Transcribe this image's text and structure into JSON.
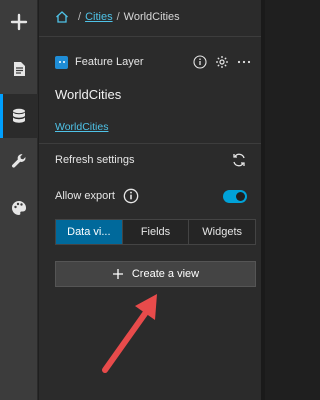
{
  "rail": {
    "items": [
      {
        "icon": "plus-icon"
      },
      {
        "icon": "page-icon"
      },
      {
        "icon": "data-icon",
        "active": true
      },
      {
        "icon": "wrench-icon"
      },
      {
        "icon": "palette-icon"
      }
    ]
  },
  "breadcrumb": {
    "home_icon": "home-icon",
    "link": "Cities",
    "current": "WorldCities",
    "separator": "/"
  },
  "layer": {
    "type_label": "Feature Layer",
    "title": "WorldCities",
    "link_text": "WorldCities"
  },
  "settings": {
    "refresh_label": "Refresh settings",
    "export_label": "Allow export",
    "export_enabled": true
  },
  "tabs": [
    {
      "label": "Data vi...",
      "active": true
    },
    {
      "label": "Fields",
      "active": false
    },
    {
      "label": "Widgets",
      "active": false
    }
  ],
  "create_button": {
    "label": "Create a view"
  },
  "colors": {
    "accent": "#00a2d8",
    "active_tab": "#00699b",
    "link": "#4fc3e8",
    "arrow": "#e84b4b"
  }
}
